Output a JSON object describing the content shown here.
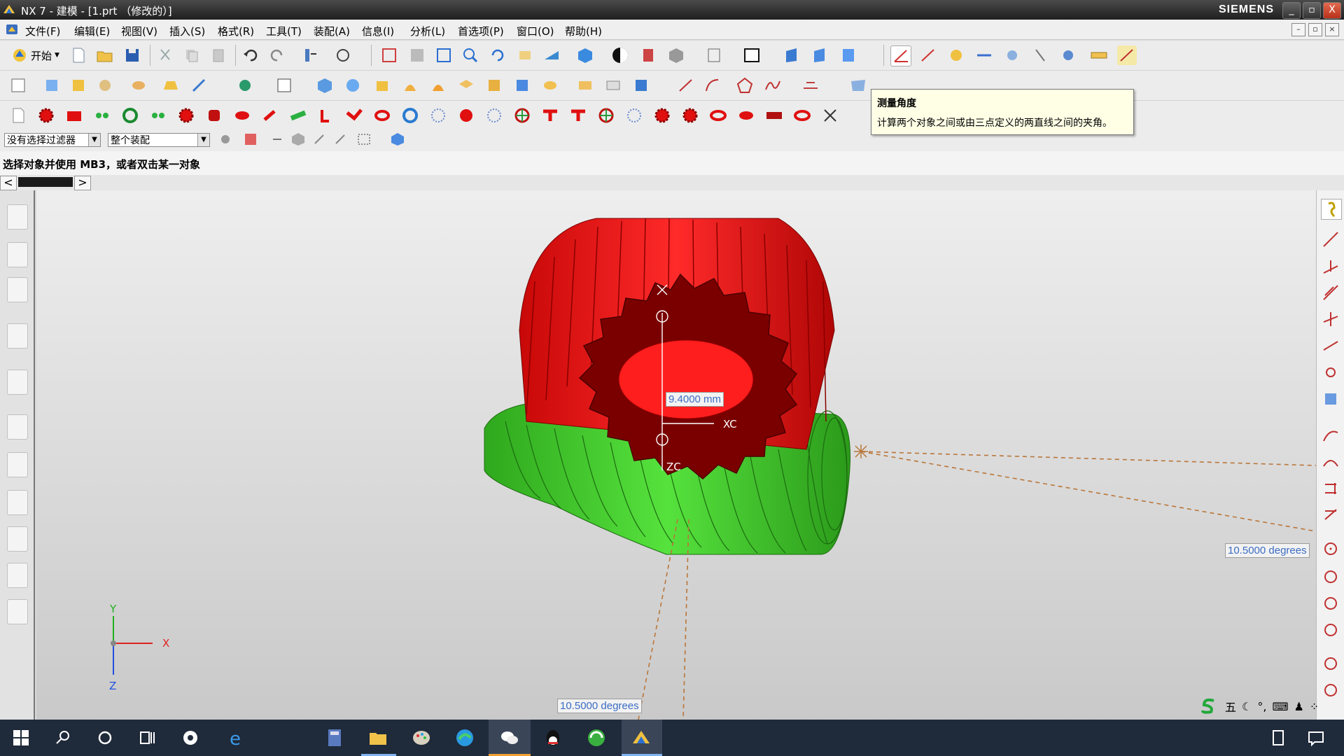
{
  "window": {
    "title": "NX 7 - 建模 - [1.prt （修改的）]",
    "brand": "SIEMENS",
    "controls": {
      "minimize": "_",
      "maximize": "▫",
      "close": "X"
    }
  },
  "menu": {
    "items": [
      "文件(F)",
      "编辑(E)",
      "视图(V)",
      "插入(S)",
      "格式(R)",
      "工具(T)",
      "装配(A)",
      "信息(I)",
      "分析(L)",
      "首选项(P)",
      "窗口(O)",
      "帮助(H)"
    ],
    "mdi_controls": {
      "minimize": "–",
      "restore": "▫",
      "close": "×"
    }
  },
  "toolbar": {
    "start_label": "开始"
  },
  "selection": {
    "filter_value": "没有选择过滤器",
    "scope_value": "整个装配"
  },
  "cue_line": "选择对象并使用 MB3，或者双击某一对象",
  "tabbar": {
    "prev": "<",
    "next": ">"
  },
  "tooltip": {
    "title": "测量角度",
    "description": "计算两个对象之间或由三点定义的两直线之间的夹角。"
  },
  "model": {
    "gear_color": "#e81010",
    "gear_face_color": "#7a0000",
    "worm_color": "#3fd02a",
    "measure_line_color": "#b9763a"
  },
  "measurements": {
    "distance": "9.4000 mm",
    "angle_bottom": "10.5000 degrees",
    "angle_right": "10.5000 degrees"
  },
  "wcs_labels": {
    "xc": "XC",
    "zc": "ZC"
  },
  "triad": {
    "x": "X",
    "y": "Y",
    "z": "Z"
  },
  "ime": {
    "mode": "五"
  }
}
